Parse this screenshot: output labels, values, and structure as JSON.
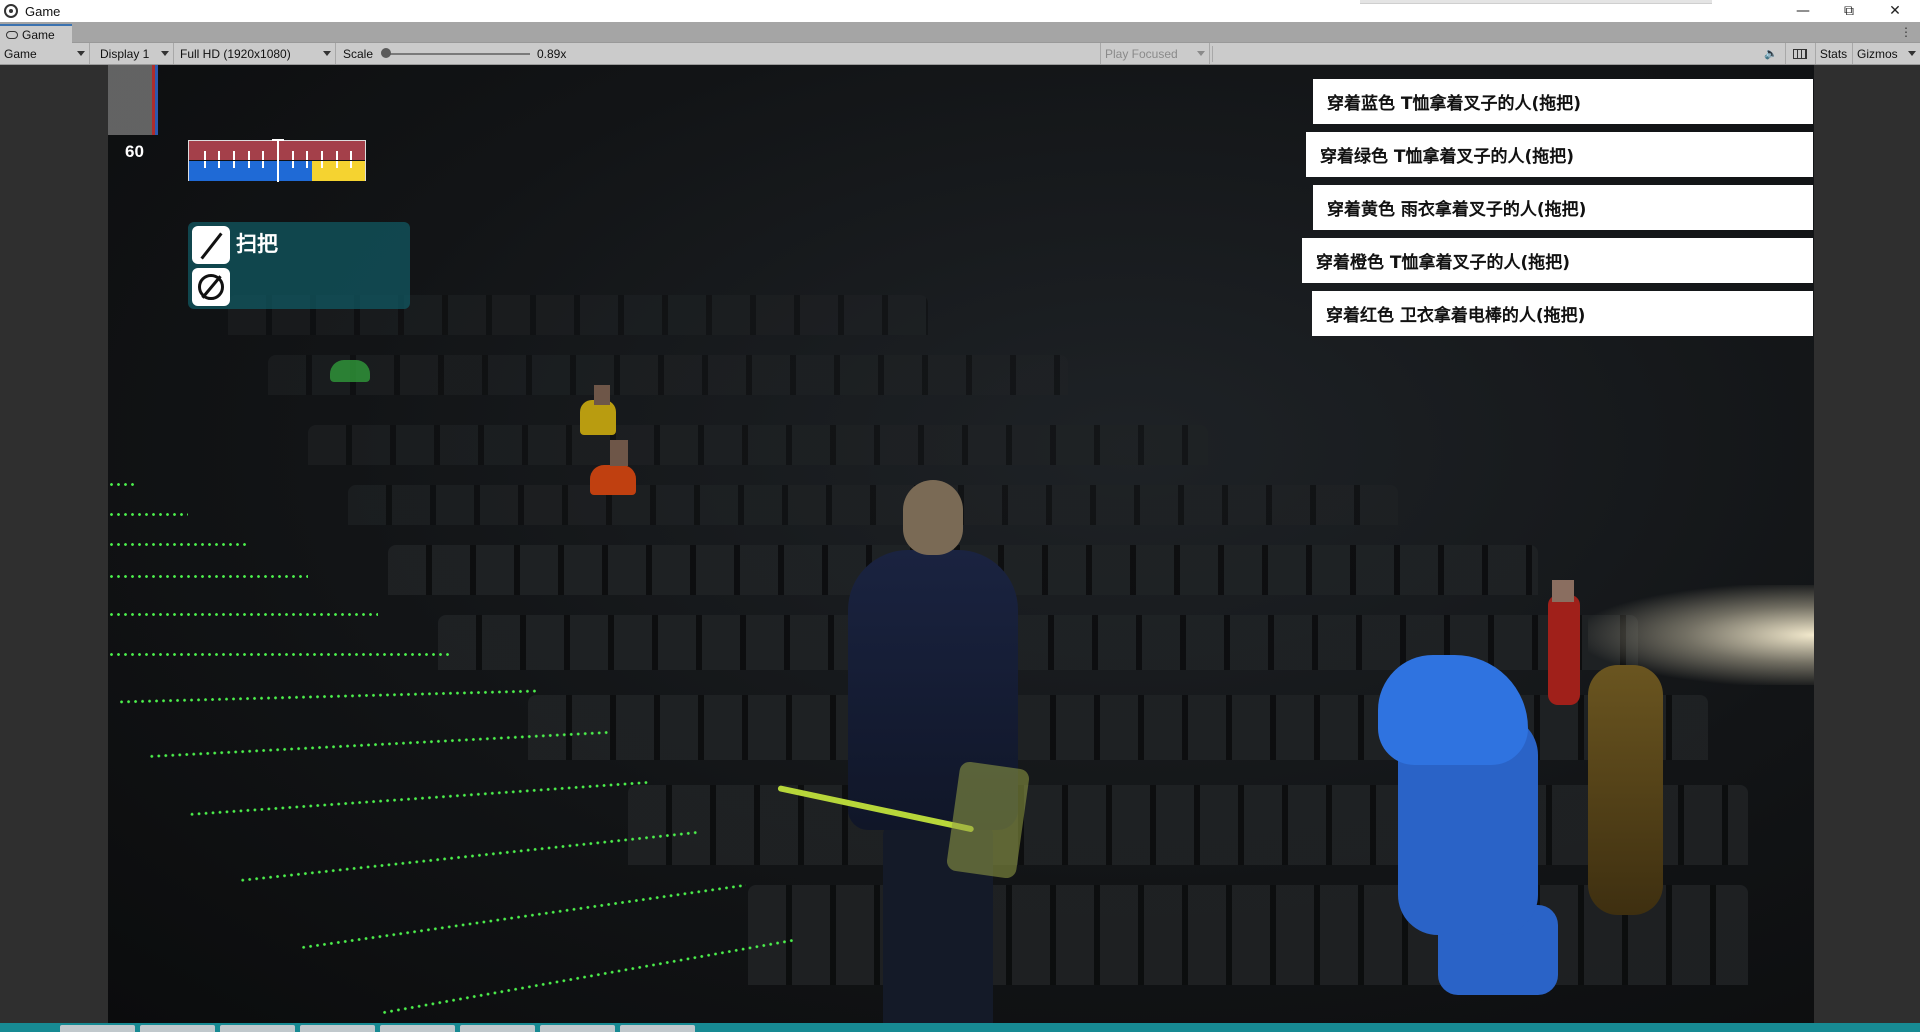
{
  "window": {
    "title": "Game"
  },
  "tab": {
    "label": "Game"
  },
  "toolbar": {
    "view_mode": "Game",
    "display": "Display 1",
    "resolution": "Full HD (1920x1080)",
    "scale_label": "Scale",
    "scale_value": "0.89x",
    "play_focused": "Play Focused",
    "stats": "Stats",
    "gizmos": "Gizmos"
  },
  "hud": {
    "fps": "60",
    "meter_fill_fraction": 0.3,
    "inventory": [
      {
        "icon": "broom-icon",
        "label": "扫把"
      },
      {
        "icon": "none-icon",
        "label": ""
      }
    ]
  },
  "targets": [
    "穿着蓝色 T恤拿着叉子的人(拖把)",
    "穿着绿色 T恤拿着叉子的人(拖把)",
    "穿着黄色 雨衣拿着叉子的人(拖把)",
    "穿着橙色 T恤拿着叉子的人(拖把)",
    "穿着红色 卫衣拿着电棒的人(拖把)"
  ],
  "colors": {
    "meter_top": "#a4404a",
    "meter_bottom": "#1f6ad6",
    "meter_fill": "#f5d330",
    "inventory_panel": "#115a64",
    "stair_lights": "#4cf04c"
  }
}
